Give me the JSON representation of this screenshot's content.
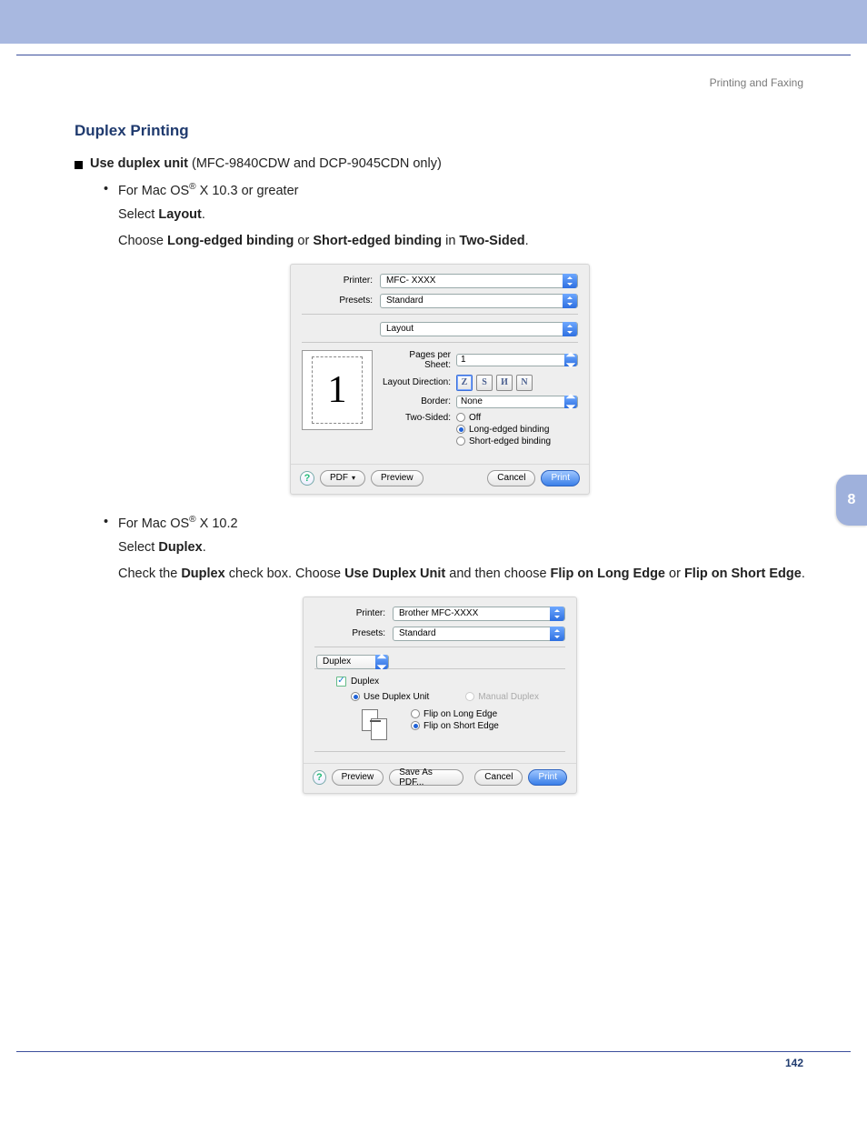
{
  "header": {
    "breadcrumb": "Printing and Faxing"
  },
  "section_title": "Duplex Printing",
  "bullet1": {
    "lead": "Use duplex unit",
    "rest": " (MFC-9840CDW and DCP-9045CDN only)"
  },
  "os103": {
    "line": "For Mac OS",
    "sup": "®",
    "tail": " X 10.3 or greater",
    "select_pre": "Select ",
    "select_b": "Layout",
    "select_post": ".",
    "choose_pre": "Choose ",
    "long": "Long-edged binding",
    "or": " or ",
    "short": "Short-edged binding",
    "in": " in ",
    "two": "Two-Sided",
    "post": "."
  },
  "dlg1": {
    "printer_label": "Printer:",
    "printer_value": "MFC- XXXX",
    "presets_label": "Presets:",
    "presets_value": "Standard",
    "pane_value": "Layout",
    "pps_label": "Pages per Sheet:",
    "pps_value": "1",
    "dir_label": "Layout Direction:",
    "border_label": "Border:",
    "border_value": "None",
    "two_label": "Two-Sided:",
    "opt_off": "Off",
    "opt_long": "Long-edged binding",
    "opt_short": "Short-edged binding",
    "big1": "1",
    "dir_glyphs": [
      "Z",
      "S",
      "И",
      "N"
    ],
    "btn_pdf": "PDF",
    "btn_preview": "Preview",
    "btn_cancel": "Cancel",
    "btn_print": "Print"
  },
  "os102": {
    "line": "For Mac OS",
    "sup": "®",
    "tail": " X 10.2",
    "select_pre": "Select ",
    "select_b": "Duplex",
    "select_post": ".",
    "p_pre": "Check the ",
    "p_b1": "Duplex",
    "p_mid1": " check box. Choose ",
    "p_b2": "Use Duplex Unit",
    "p_mid2": " and then choose ",
    "p_b3": "Flip on Long Edge",
    "p_or": " or ",
    "p_b4": "Flip on Short Edge",
    "p_post": "."
  },
  "dlg2": {
    "printer_label": "Printer:",
    "printer_value": "Brother MFC-XXXX",
    "presets_label": "Presets:",
    "presets_value": "Standard",
    "tab_value": "Duplex",
    "chk_label": "Duplex",
    "opt_use": "Use Duplex Unit",
    "opt_manual": "Manual Duplex",
    "opt_long": "Flip on Long Edge",
    "opt_short": "Flip on Short Edge",
    "btn_preview": "Preview",
    "btn_save": "Save As PDF...",
    "btn_cancel": "Cancel",
    "btn_print": "Print"
  },
  "sidetab": "8",
  "pagenum": "142",
  "glyphs": {
    "help": "?",
    "check": "✓",
    "tri": "▾"
  }
}
